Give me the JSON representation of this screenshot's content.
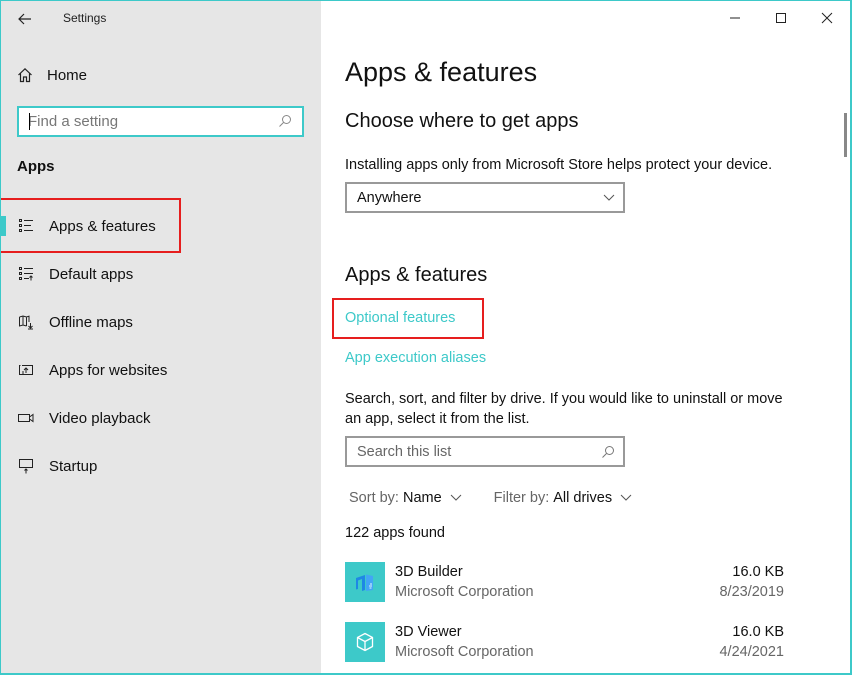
{
  "window": {
    "title": "Settings",
    "controls": {
      "minimize": "minimize",
      "maximize": "maximize",
      "close": "close"
    },
    "accent_color": "#3dc9c9",
    "highlight_color": "#e61e1e"
  },
  "sidebar": {
    "home_label": "Home",
    "search": {
      "placeholder": "Find a setting",
      "value": ""
    },
    "section_label": "Apps",
    "items": [
      {
        "label": "Apps & features",
        "icon": "apps-features-list-icon",
        "selected": true
      },
      {
        "label": "Default apps",
        "icon": "default-apps-icon",
        "selected": false
      },
      {
        "label": "Offline maps",
        "icon": "offline-maps-icon",
        "selected": false
      },
      {
        "label": "Apps for websites",
        "icon": "apps-for-websites-icon",
        "selected": false
      },
      {
        "label": "Video playback",
        "icon": "video-camera-icon",
        "selected": false
      },
      {
        "label": "Startup",
        "icon": "startup-monitor-icon",
        "selected": false
      }
    ]
  },
  "main": {
    "page_title": "Apps & features",
    "choose_section": {
      "heading": "Choose where to get apps",
      "description": "Installing apps only from Microsoft Store helps protect your device.",
      "dropdown_value": "Anywhere"
    },
    "apps_section": {
      "heading": "Apps & features",
      "links": [
        "Optional features",
        "App execution aliases"
      ],
      "description": "Search, sort, and filter by drive. If you would like to uninstall or move an app, select it from the list.",
      "search": {
        "placeholder": "Search this list",
        "value": ""
      },
      "sort": {
        "label": "Sort by:",
        "value": "Name"
      },
      "filter": {
        "label": "Filter by:",
        "value": "All drives"
      },
      "count_text": "122 apps found",
      "apps": [
        {
          "name": "3D Builder",
          "publisher": "Microsoft Corporation",
          "size": "16.0 KB",
          "date": "8/23/2019",
          "icon": "3d-builder-icon"
        },
        {
          "name": "3D Viewer",
          "publisher": "Microsoft Corporation",
          "size": "16.0 KB",
          "date": "4/24/2021",
          "icon": "3d-viewer-cube-icon"
        }
      ]
    }
  }
}
